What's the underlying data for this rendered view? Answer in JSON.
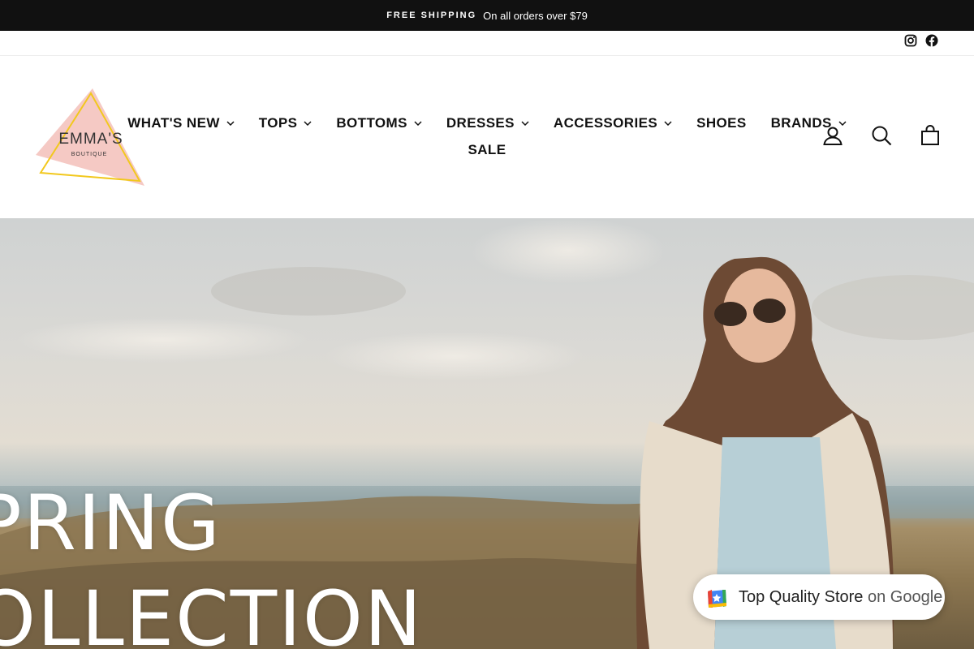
{
  "announcement": {
    "bold": "FREE SHIPPING",
    "text": "On all orders over $79"
  },
  "social": [
    "instagram-icon",
    "facebook-icon"
  ],
  "logo": {
    "name": "EMMA'S",
    "tagline": "BOUTIQUE",
    "colors": {
      "triangle_fill": "#f5c9c4",
      "triangle_outline": "#f2c81d"
    }
  },
  "nav": {
    "row1": [
      {
        "label": "WHAT'S NEW",
        "dropdown": true
      },
      {
        "label": "TOPS",
        "dropdown": true
      },
      {
        "label": "BOTTOMS",
        "dropdown": true
      },
      {
        "label": "DRESSES",
        "dropdown": true
      },
      {
        "label": "ACCESSORIES",
        "dropdown": true
      },
      {
        "label": "SHOES",
        "dropdown": false
      },
      {
        "label": "BRANDS",
        "dropdown": true
      }
    ],
    "row2": [
      {
        "label": "SALE",
        "dropdown": false
      }
    ]
  },
  "header_icons": [
    "account-icon",
    "search-icon",
    "cart-icon"
  ],
  "hero": {
    "line1": "PRING",
    "line2": "OLLECTION"
  },
  "badge": {
    "text": "Top Quality Store",
    "suffix": "on Google"
  },
  "colors": {
    "announce_bg": "#111111",
    "text": "#111111"
  }
}
